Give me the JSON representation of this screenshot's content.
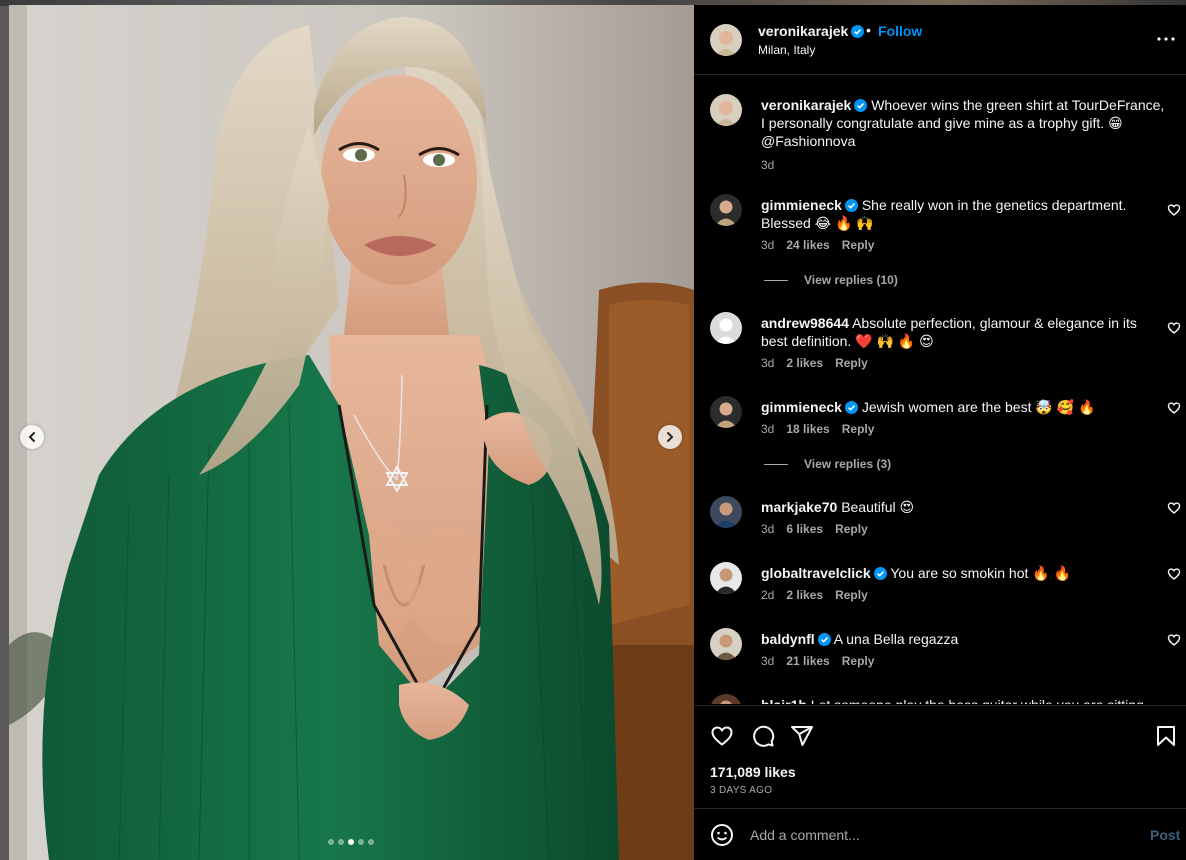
{
  "post": {
    "username": "veronikarajek",
    "follow_label": "Follow",
    "separator": "•",
    "location": "Milan, Italy",
    "caption": "Whoever wins the green shirt at TourDeFrance, I personally congratulate and give mine as a trophy gift. 😁 @Fashionnova",
    "caption_time": "3d",
    "likes": "171,089 likes",
    "date": "3 DAYS AGO",
    "carousel_count": 5,
    "carousel_active": 3
  },
  "comments": [
    {
      "user": "gimmieneck",
      "verified": true,
      "text": "She really won in the genetics department. Blessed 😂 🔥 🙌",
      "time": "3d",
      "likes": "24 likes",
      "reply": "Reply",
      "view_replies": "View replies (10)"
    },
    {
      "user": "andrew98644",
      "verified": false,
      "text": "Absolute perfection, glamour & elegance in its best definition. ❤️ 🙌 🔥 😍",
      "time": "3d",
      "likes": "2 likes",
      "reply": "Reply"
    },
    {
      "user": "gimmieneck",
      "verified": true,
      "text": "Jewish women are the best 🤯 🥰 🔥",
      "time": "3d",
      "likes": "18 likes",
      "reply": "Reply",
      "view_replies": "View replies (3)"
    },
    {
      "user": "markjake70",
      "verified": false,
      "text": "Beautiful 😍",
      "time": "3d",
      "likes": "6 likes",
      "reply": "Reply"
    },
    {
      "user": "globaltravelclick",
      "verified": true,
      "text": "You are so smokin hot 🔥 🔥",
      "time": "2d",
      "likes": "2 likes",
      "reply": "Reply"
    },
    {
      "user": "baldynfl",
      "verified": true,
      "text": "A una Bella regazza",
      "time": "3d",
      "likes": "21 likes",
      "reply": "Reply"
    },
    {
      "user": "blair1b",
      "verified": false,
      "text": "Let someone play the bass guitar while you are sitting"
    }
  ],
  "add_comment": {
    "placeholder": "Add a comment...",
    "post_label": "Post"
  },
  "colors": {
    "accent": "#0095f6",
    "background": "#000000",
    "muted": "#a8a8a8",
    "like_red": "#ff3040"
  },
  "icons": [
    "chevron-left-icon",
    "chevron-right-icon",
    "more-icon",
    "heart-icon",
    "comment-icon",
    "share-icon",
    "bookmark-icon",
    "emoji-icon",
    "verified-icon"
  ]
}
